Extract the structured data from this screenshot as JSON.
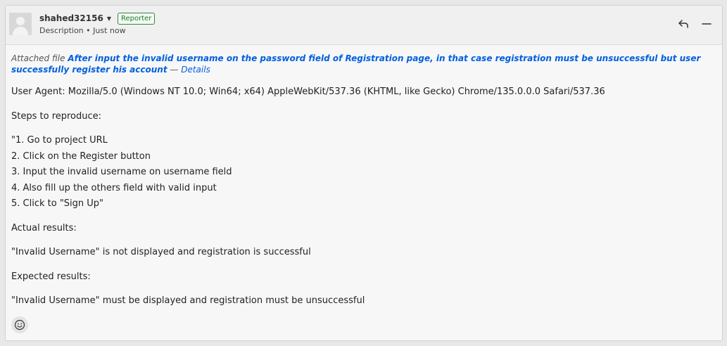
{
  "comment": {
    "author": "shahed32156",
    "role_badge": "Reporter",
    "meta": "Description • Just now"
  },
  "attachment": {
    "prefix": "Attached file ",
    "title": "After input the invalid username on the password field of Registration page, in that case registration must be unsuccessful but user successfully register his account",
    "separator": " — ",
    "details_label": "Details"
  },
  "body": {
    "user_agent": "User Agent: Mozilla/5.0 (Windows NT 10.0; Win64; x64) AppleWebKit/537.36 (KHTML, like Gecko) Chrome/135.0.0.0 Safari/537.36",
    "steps_heading": "Steps to reproduce:",
    "steps": [
      "\"1. Go to project URL",
      "2. Click on the Register button",
      "3. Input the invalid username on username field",
      "4. Also fill up the others field with valid input",
      "5. Click to \"Sign Up\""
    ],
    "actual_heading": "Actual results:",
    "actual_text": "\"Invalid Username\" is not displayed and registration is successful",
    "expected_heading": "Expected results:",
    "expected_text": "\"Invalid Username\" must be displayed and registration must be unsuccessful"
  },
  "icons": {
    "reply": "reply-icon",
    "collapse": "collapse-icon",
    "emoji": "emoji-icon",
    "caret": "caret-down-icon"
  },
  "colors": {
    "link": "#0060df",
    "badge_border": "#2e8b3e",
    "card_bg": "#f7f7f7",
    "header_bg": "#f0f0f0"
  }
}
